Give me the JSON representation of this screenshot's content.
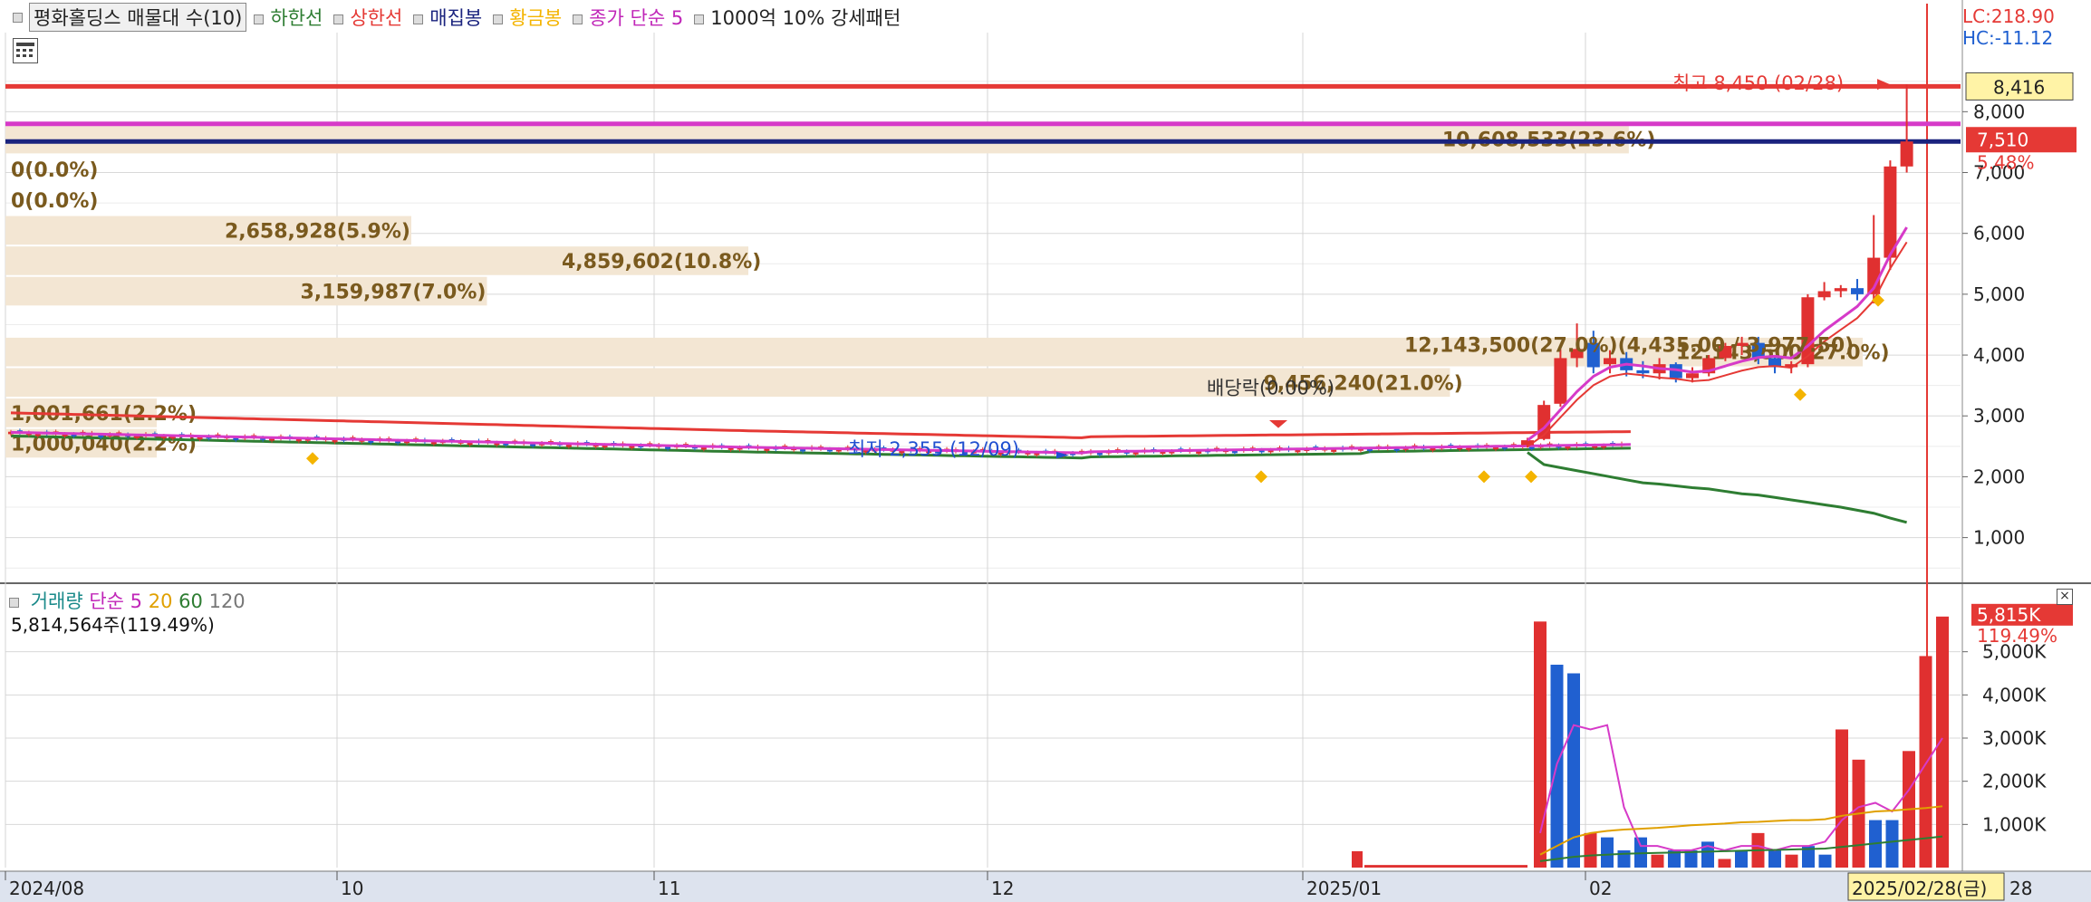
{
  "header": {
    "title": "평화홀딩스 매물대 수(10)",
    "legend_items": [
      {
        "label": "하한선",
        "color": "#2e7d32"
      },
      {
        "label": "상한선",
        "color": "#e53935"
      },
      {
        "label": "매집봉",
        "color": "#1a237e"
      },
      {
        "label": "황금봉",
        "color": "#f4b400"
      },
      {
        "label": "종가 단순 5",
        "color": "#c026b8"
      },
      {
        "label": "1000억 10% 강세패턴",
        "color": "#222222"
      }
    ],
    "lc": "LC:218.90",
    "hc": "HC:-11.12"
  },
  "volume_panel": {
    "legend": {
      "name": "거래량",
      "ma_label": "단순",
      "periods": [
        "5",
        "20",
        "60",
        "120"
      ]
    },
    "summary": "5,814,564주(119.49%)",
    "badge_value": "5,815K",
    "badge_pct": "119.49%",
    "y_ticks": [
      "1,000K",
      "2,000K",
      "3,000K",
      "4,000K",
      "5,000K"
    ]
  },
  "price_badges": {
    "high_box": "8,416",
    "current": "7,510",
    "change_pct": "5.48%"
  },
  "annotations": {
    "highest": "최고 8,450 (02/28)",
    "lowest": "최저 2,355 (12/09)",
    "dividend": "배당락(0.00%)",
    "pattern_label": "12,143,500(27.0%)(4,435.00 / 3,977.50)"
  },
  "colors": {
    "up": "#e03030",
    "down": "#2060d0",
    "ma5": "#d63ac8",
    "lower_band": "#2e7d32",
    "upper_band": "#e53935",
    "gold": "#f4b400",
    "accum": "#1a237e",
    "profile_fill": "#f3e6d3",
    "profile_text": "#7a5a1e",
    "axis_bg": "#dde3ee",
    "date_highlight": "#fff3a6"
  },
  "chart_data": [
    {
      "type": "volume_profile",
      "price_axis": {
        "ticks": [
          1000,
          2000,
          3000,
          4000,
          5000,
          6000,
          7000,
          8000
        ],
        "range": [
          250,
          9300
        ]
      },
      "bins": [
        {
          "label": "10,608,533(23.6%)",
          "low": 7300,
          "high": 7800,
          "share": 23.6
        },
        {
          "label": "0(0.0%)",
          "low": 6800,
          "high": 7300,
          "share": 0.0
        },
        {
          "label": "0(0.0%)",
          "low": 6300,
          "high": 6800,
          "share": 0.0
        },
        {
          "label": "2,658,928(5.9%)",
          "low": 5800,
          "high": 6300,
          "share": 5.9
        },
        {
          "label": "4,859,602(10.8%)",
          "low": 5300,
          "high": 5800,
          "share": 10.8
        },
        {
          "label": "3,159,987(7.0%)",
          "low": 4800,
          "high": 5300,
          "share": 7.0
        },
        {
          "label": "12,143,500(27.0%)",
          "low": 3800,
          "high": 4300,
          "share": 27.0
        },
        {
          "label": "9,456,240(21.0%)",
          "low": 3300,
          "high": 3800,
          "share": 21.0
        },
        {
          "label": "1,001,661(2.2%)",
          "low": 2800,
          "high": 3300,
          "share": 2.2
        },
        {
          "label": "1,000,040(2.2%)",
          "low": 2300,
          "high": 2800,
          "share": 2.2
        }
      ],
      "horizontal_lines": [
        {
          "price": 8416,
          "color": "#e53935"
        },
        {
          "price": 7800,
          "color": "#d63ac8"
        },
        {
          "price": 7510,
          "color": "#1a237e"
        }
      ]
    },
    {
      "type": "candlestick",
      "x_labels": [
        "2024/08",
        "10",
        "11",
        "12",
        "2025/01",
        "02",
        "2025/02/28(금)",
        "28"
      ],
      "period_index_labels": {
        "2024/08": 0,
        "10": 35,
        "11": 70,
        "12": 105,
        "2025/01": 138,
        "02": 167
      },
      "last_date": "2025/02/28(금)",
      "flat_segment": {
        "from": 0,
        "to": 160,
        "start_price": 2720,
        "mid_price": 2470,
        "min_price": 2355,
        "end_price": 2500
      },
      "recent_candles": [
        {
          "o": 2520,
          "h": 2640,
          "l": 2480,
          "c": 2600
        },
        {
          "o": 2620,
          "h": 3250,
          "l": 2600,
          "c": 3180
        },
        {
          "o": 3200,
          "h": 4100,
          "l": 3150,
          "c": 3950
        },
        {
          "o": 3950,
          "h": 4520,
          "l": 3800,
          "c": 4100
        },
        {
          "o": 4200,
          "h": 4400,
          "l": 3700,
          "c": 3800
        },
        {
          "o": 3850,
          "h": 4080,
          "l": 3700,
          "c": 3950
        },
        {
          "o": 3950,
          "h": 4050,
          "l": 3650,
          "c": 3750
        },
        {
          "o": 3750,
          "h": 3900,
          "l": 3620,
          "c": 3700
        },
        {
          "o": 3700,
          "h": 3950,
          "l": 3600,
          "c": 3850
        },
        {
          "o": 3850,
          "h": 3880,
          "l": 3550,
          "c": 3620
        },
        {
          "o": 3620,
          "h": 3800,
          "l": 3550,
          "c": 3700
        },
        {
          "o": 3700,
          "h": 4000,
          "l": 3650,
          "c": 3950
        },
        {
          "o": 3950,
          "h": 4200,
          "l": 3900,
          "c": 4150
        },
        {
          "o": 4150,
          "h": 4300,
          "l": 4000,
          "c": 4200
        },
        {
          "o": 4200,
          "h": 4300,
          "l": 3850,
          "c": 3950
        },
        {
          "o": 3950,
          "h": 4000,
          "l": 3700,
          "c": 3800
        },
        {
          "o": 3800,
          "h": 3900,
          "l": 3700,
          "c": 3850
        },
        {
          "o": 3850,
          "h": 5000,
          "l": 3800,
          "c": 4950
        },
        {
          "o": 4950,
          "h": 5200,
          "l": 4900,
          "c": 5050
        },
        {
          "o": 5050,
          "h": 5150,
          "l": 4950,
          "c": 5100
        },
        {
          "o": 5100,
          "h": 5250,
          "l": 4900,
          "c": 5000
        },
        {
          "o": 5000,
          "h": 6300,
          "l": 4850,
          "c": 5600
        },
        {
          "o": 5600,
          "h": 7200,
          "l": 5400,
          "c": 7100
        },
        {
          "o": 7100,
          "h": 8450,
          "l": 7000,
          "c": 7510
        }
      ],
      "ma5_end": [
        2600,
        2800,
        3100,
        3400,
        3650,
        3800,
        3850,
        3820,
        3780,
        3760,
        3720,
        3740,
        3820,
        3900,
        3960,
        3980,
        3950,
        4150,
        4400,
        4600,
        4800,
        5100,
        5650,
        6100
      ],
      "lower_band_end": [
        2400,
        2200,
        2150,
        2100,
        2050,
        2000,
        1950,
        1900,
        1880,
        1850,
        1820,
        1800,
        1760,
        1720,
        1700,
        1660,
        1620,
        1580,
        1540,
        1500,
        1450,
        1400,
        1320,
        1250
      ]
    },
    {
      "type": "bar",
      "series": [
        {
          "name": "거래량",
          "values_k": [
            5700,
            4700,
            4500,
            800,
            700,
            400,
            700,
            300,
            400,
            400,
            600,
            200,
            400,
            800,
            400,
            300,
            500,
            300,
            3200,
            2500,
            1100,
            1100,
            2700,
            4900,
            5815
          ]
        }
      ],
      "ma5_k": [
        800,
        2400,
        3300,
        3200,
        3300,
        1400,
        500,
        500,
        400,
        400,
        500,
        400,
        500,
        500,
        400,
        500,
        500,
        600,
        1100,
        1400,
        1500,
        1300,
        1800,
        2400,
        3000
      ],
      "ma20_k": [
        300,
        500,
        700,
        800,
        850,
        880,
        900,
        920,
        950,
        980,
        1000,
        1020,
        1050,
        1060,
        1080,
        1100,
        1100,
        1120,
        1200,
        1250,
        1300,
        1320,
        1350,
        1380,
        1420
      ],
      "ma60_k": [
        150,
        200,
        250,
        280,
        300,
        320,
        330,
        340,
        350,
        360,
        370,
        380,
        390,
        400,
        410,
        420,
        430,
        440,
        480,
        520,
        560,
        600,
        640,
        680,
        720
      ],
      "ylim_k": [
        0,
        6000
      ]
    }
  ]
}
